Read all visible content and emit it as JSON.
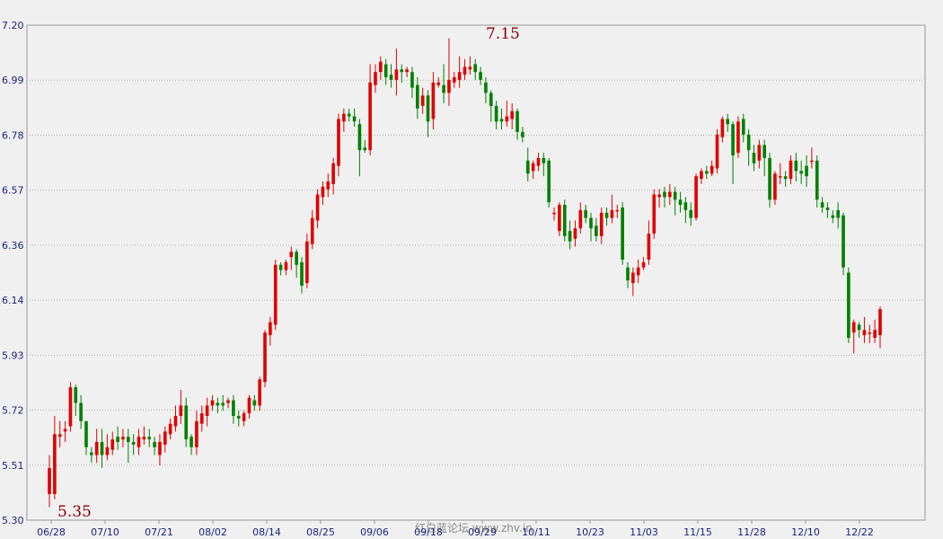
{
  "chart_data": {
    "type": "candlestick",
    "title": "",
    "xlabel": "",
    "ylabel": "",
    "ylim": [
      5.3,
      7.2
    ],
    "y_ticks": [
      "7.20",
      "6.99",
      "6.78",
      "6.57",
      "6.36",
      "6.14",
      "5.93",
      "5.72",
      "5.51",
      "5.30"
    ],
    "x_ticks": [
      "06/28",
      "07/10",
      "07/21",
      "08/02",
      "08/14",
      "08/25",
      "09/06",
      "09/18",
      "09/29",
      "10/11",
      "10/23",
      "11/03",
      "11/15",
      "11/28",
      "12/10",
      "12/22"
    ],
    "grid": true,
    "colors": {
      "up": "#e00000",
      "down": "#008000",
      "grid": "#b0b0b0",
      "axis": "#999999",
      "annotation": "#8b0000"
    },
    "annotations": {
      "low_label": "5.35",
      "high_label": "7.15"
    },
    "watermark": "红白蓝论坛 www.zhv.in",
    "candles": [
      [
        5.4,
        5.5,
        5.55,
        5.35
      ],
      [
        5.4,
        5.63,
        5.7,
        5.38
      ],
      [
        5.62,
        5.63,
        5.68,
        5.58
      ],
      [
        5.64,
        5.65,
        5.68,
        5.6
      ],
      [
        5.66,
        5.81,
        5.83,
        5.64
      ],
      [
        5.81,
        5.75,
        5.82,
        5.7
      ],
      [
        5.75,
        5.68,
        5.78,
        5.65
      ],
      [
        5.68,
        5.58,
        5.68,
        5.55
      ],
      [
        5.56,
        5.55,
        5.58,
        5.52
      ],
      [
        5.55,
        5.6,
        5.65,
        5.52
      ],
      [
        5.6,
        5.55,
        5.65,
        5.5
      ],
      [
        5.55,
        5.58,
        5.63,
        5.53
      ],
      [
        5.57,
        5.61,
        5.64,
        5.55
      ],
      [
        5.62,
        5.6,
        5.66,
        5.57
      ],
      [
        5.61,
        5.62,
        5.65,
        5.58
      ],
      [
        5.62,
        5.6,
        5.65,
        5.52
      ],
      [
        5.6,
        5.59,
        5.63,
        5.55
      ],
      [
        5.58,
        5.62,
        5.65,
        5.55
      ],
      [
        5.61,
        5.62,
        5.66,
        5.59
      ],
      [
        5.62,
        5.61,
        5.65,
        5.58
      ],
      [
        5.6,
        5.58,
        5.62,
        5.55
      ],
      [
        5.55,
        5.6,
        5.63,
        5.51
      ],
      [
        5.59,
        5.64,
        5.66,
        5.56
      ],
      [
        5.63,
        5.67,
        5.69,
        5.61
      ],
      [
        5.66,
        5.7,
        5.74,
        5.64
      ],
      [
        5.7,
        5.74,
        5.8,
        5.67
      ],
      [
        5.74,
        5.61,
        5.77,
        5.58
      ],
      [
        5.62,
        5.58,
        5.63,
        5.55
      ],
      [
        5.58,
        5.68,
        5.72,
        5.55
      ],
      [
        5.67,
        5.71,
        5.74,
        5.64
      ],
      [
        5.7,
        5.74,
        5.77,
        5.66
      ],
      [
        5.74,
        5.76,
        5.78,
        5.72
      ],
      [
        5.75,
        5.74,
        5.77,
        5.71
      ],
      [
        5.75,
        5.74,
        5.78,
        5.72
      ],
      [
        5.75,
        5.76,
        5.77,
        5.73
      ],
      [
        5.76,
        5.7,
        5.78,
        5.67
      ],
      [
        5.7,
        5.69,
        5.72,
        5.66
      ],
      [
        5.68,
        5.71,
        5.72,
        5.66
      ],
      [
        5.71,
        5.77,
        5.78,
        5.69
      ],
      [
        5.76,
        5.74,
        5.78,
        5.72
      ],
      [
        5.74,
        5.84,
        5.85,
        5.72
      ],
      [
        5.83,
        6.02,
        6.03,
        5.81
      ],
      [
        6.01,
        6.06,
        6.08,
        5.97
      ],
      [
        6.05,
        6.28,
        6.3,
        6.03
      ],
      [
        6.28,
        6.26,
        6.29,
        6.24
      ],
      [
        6.26,
        6.29,
        6.3,
        6.24
      ],
      [
        6.31,
        6.33,
        6.35,
        6.26
      ],
      [
        6.33,
        6.28,
        6.34,
        6.23
      ],
      [
        6.29,
        6.2,
        6.31,
        6.17
      ],
      [
        6.21,
        6.37,
        6.4,
        6.19
      ],
      [
        6.36,
        6.46,
        6.49,
        6.34
      ],
      [
        6.45,
        6.55,
        6.57,
        6.42
      ],
      [
        6.54,
        6.58,
        6.6,
        6.51
      ],
      [
        6.57,
        6.6,
        6.63,
        6.54
      ],
      [
        6.59,
        6.67,
        6.69,
        6.55
      ],
      [
        6.66,
        6.84,
        6.86,
        6.62
      ],
      [
        6.83,
        6.86,
        6.88,
        6.79
      ],
      [
        6.86,
        6.85,
        6.88,
        6.83
      ],
      [
        6.85,
        6.83,
        6.88,
        6.81
      ],
      [
        6.82,
        6.72,
        6.84,
        6.62
      ],
      [
        6.73,
        6.72,
        6.76,
        6.71
      ],
      [
        6.72,
        6.98,
        7.05,
        6.7
      ],
      [
        6.97,
        7.02,
        7.05,
        6.94
      ],
      [
        7.02,
        7.06,
        7.08,
        6.99
      ],
      [
        7.05,
        7.0,
        7.07,
        6.97
      ],
      [
        7.01,
        6.99,
        7.05,
        6.96
      ],
      [
        6.99,
        7.03,
        7.11,
        6.93
      ],
      [
        7.03,
        7.02,
        7.05,
        6.98
      ],
      [
        7.02,
        7.03,
        7.04,
        7.0
      ],
      [
        7.02,
        6.96,
        7.04,
        6.92
      ],
      [
        6.97,
        6.88,
        7.0,
        6.84
      ],
      [
        6.89,
        6.93,
        6.96,
        6.86
      ],
      [
        6.93,
        6.83,
        6.95,
        6.77
      ],
      [
        6.84,
        6.98,
        7.02,
        6.8
      ],
      [
        6.97,
        6.98,
        7.0,
        6.96
      ],
      [
        6.97,
        6.94,
        7.05,
        6.9
      ],
      [
        6.94,
        6.99,
        7.15,
        6.89
      ],
      [
        6.98,
        7.0,
        7.02,
        6.96
      ],
      [
        6.99,
        7.02,
        7.08,
        6.96
      ],
      [
        7.01,
        7.04,
        7.07,
        6.99
      ],
      [
        7.03,
        7.04,
        7.08,
        7.01
      ],
      [
        7.05,
        7.02,
        7.07,
        6.99
      ],
      [
        7.02,
        6.99,
        7.04,
        6.97
      ],
      [
        6.98,
        6.94,
        7.0,
        6.9
      ],
      [
        6.94,
        6.89,
        6.95,
        6.83
      ],
      [
        6.89,
        6.83,
        6.91,
        6.8
      ],
      [
        6.84,
        6.83,
        6.88,
        6.8
      ],
      [
        6.83,
        6.85,
        6.91,
        6.81
      ],
      [
        6.84,
        6.87,
        6.9,
        6.8
      ],
      [
        6.87,
        6.79,
        6.88,
        6.76
      ],
      [
        6.79,
        6.77,
        6.81,
        6.75
      ],
      [
        6.68,
        6.63,
        6.73,
        6.6
      ],
      [
        6.64,
        6.67,
        6.68,
        6.61
      ],
      [
        6.66,
        6.69,
        6.71,
        6.64
      ],
      [
        6.69,
        6.67,
        6.71,
        6.62
      ],
      [
        6.68,
        6.52,
        6.69,
        6.5
      ],
      [
        6.48,
        6.48,
        6.5,
        6.45
      ],
      [
        6.41,
        6.51,
        6.52,
        6.39
      ],
      [
        6.51,
        6.39,
        6.53,
        6.37
      ],
      [
        6.41,
        6.37,
        6.45,
        6.34
      ],
      [
        6.38,
        6.42,
        6.45,
        6.35
      ],
      [
        6.42,
        6.49,
        6.52,
        6.4
      ],
      [
        6.49,
        6.46,
        6.51,
        6.44
      ],
      [
        6.46,
        6.42,
        6.48,
        6.37
      ],
      [
        6.43,
        6.39,
        6.46,
        6.37
      ],
      [
        6.39,
        6.48,
        6.5,
        6.36
      ],
      [
        6.48,
        6.46,
        6.5,
        6.43
      ],
      [
        6.46,
        6.49,
        6.55,
        6.44
      ],
      [
        6.49,
        6.49,
        6.51,
        6.46
      ],
      [
        6.5,
        6.3,
        6.52,
        6.28
      ],
      [
        6.27,
        6.22,
        6.29,
        6.19
      ],
      [
        6.21,
        6.25,
        6.27,
        6.16
      ],
      [
        6.24,
        6.27,
        6.3,
        6.21
      ],
      [
        6.27,
        6.29,
        6.31,
        6.26
      ],
      [
        6.3,
        6.4,
        6.45,
        6.28
      ],
      [
        6.4,
        6.55,
        6.57,
        6.38
      ],
      [
        6.54,
        6.55,
        6.57,
        6.5
      ],
      [
        6.56,
        6.54,
        6.58,
        6.5
      ],
      [
        6.54,
        6.56,
        6.59,
        6.51
      ],
      [
        6.56,
        6.53,
        6.58,
        6.47
      ],
      [
        6.53,
        6.51,
        6.56,
        6.48
      ],
      [
        6.52,
        6.49,
        6.54,
        6.44
      ],
      [
        6.49,
        6.46,
        6.52,
        6.43
      ],
      [
        6.46,
        6.62,
        6.63,
        6.45
      ],
      [
        6.61,
        6.64,
        6.65,
        6.59
      ],
      [
        6.64,
        6.63,
        6.66,
        6.61
      ],
      [
        6.63,
        6.66,
        6.68,
        6.62
      ],
      [
        6.65,
        6.78,
        6.8,
        6.63
      ],
      [
        6.77,
        6.84,
        6.85,
        6.75
      ],
      [
        6.84,
        6.82,
        6.86,
        6.79
      ],
      [
        6.82,
        6.7,
        6.83,
        6.59
      ],
      [
        6.71,
        6.83,
        6.85,
        6.69
      ],
      [
        6.84,
        6.78,
        6.86,
        6.75
      ],
      [
        6.78,
        6.72,
        6.8,
        6.66
      ],
      [
        6.71,
        6.67,
        6.74,
        6.64
      ],
      [
        6.68,
        6.74,
        6.76,
        6.65
      ],
      [
        6.74,
        6.69,
        6.76,
        6.62
      ],
      [
        6.69,
        6.53,
        6.71,
        6.5
      ],
      [
        6.53,
        6.63,
        6.64,
        6.51
      ],
      [
        6.62,
        6.62,
        6.67,
        6.59
      ],
      [
        6.62,
        6.61,
        6.64,
        6.58
      ],
      [
        6.61,
        6.68,
        6.7,
        6.59
      ],
      [
        6.68,
        6.64,
        6.71,
        6.6
      ],
      [
        6.64,
        6.63,
        6.68,
        6.59
      ],
      [
        6.66,
        6.62,
        6.7,
        6.58
      ],
      [
        6.68,
        6.68,
        6.73,
        6.65
      ],
      [
        6.68,
        6.53,
        6.7,
        6.5
      ],
      [
        6.52,
        6.5,
        6.54,
        6.48
      ],
      [
        6.5,
        6.49,
        6.52,
        6.46
      ],
      [
        6.47,
        6.46,
        6.49,
        6.44
      ],
      [
        6.49,
        6.46,
        6.52,
        6.42
      ],
      [
        6.47,
        6.27,
        6.48,
        6.24
      ],
      [
        6.25,
        6.0,
        6.27,
        5.98
      ],
      [
        6.02,
        6.06,
        6.07,
        5.94
      ],
      [
        6.05,
        6.03,
        6.06,
        6.0
      ],
      [
        6.01,
        6.03,
        6.08,
        5.98
      ],
      [
        6.02,
        6.02,
        6.05,
        5.98
      ],
      [
        6.0,
        6.03,
        6.07,
        5.98
      ],
      [
        6.01,
        6.11,
        6.12,
        5.96
      ]
    ]
  }
}
